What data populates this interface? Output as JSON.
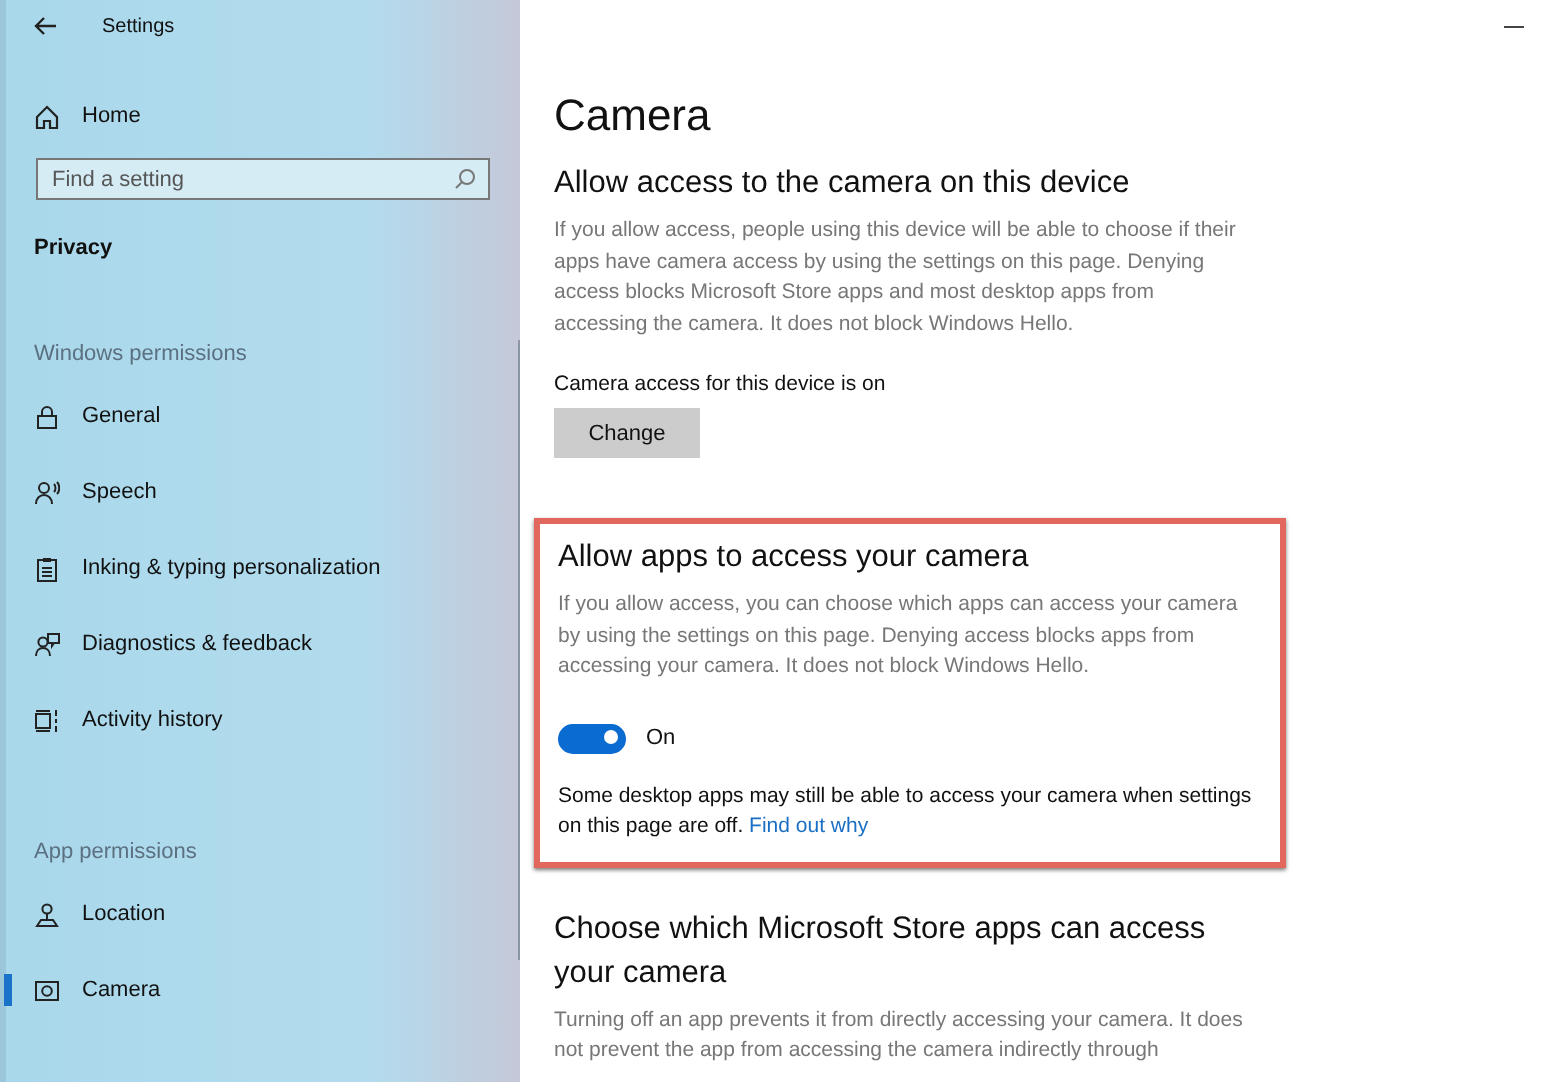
{
  "window": {
    "title": "Settings"
  },
  "sidebar": {
    "home": "Home",
    "search": {
      "placeholder": "Find a setting"
    },
    "heading": "Privacy",
    "groups": [
      {
        "title": "Windows permissions",
        "items": [
          {
            "label": "General",
            "selected": false
          },
          {
            "label": "Speech",
            "selected": false
          },
          {
            "label": "Inking & typing personalization",
            "selected": false
          },
          {
            "label": "Diagnostics & feedback",
            "selected": false
          },
          {
            "label": "Activity history",
            "selected": false
          }
        ]
      },
      {
        "title": "App permissions",
        "items": [
          {
            "label": "Location",
            "selected": false
          },
          {
            "label": "Camera",
            "selected": true
          }
        ]
      }
    ]
  },
  "page": {
    "title": "Camera",
    "device_section": {
      "heading": "Allow access to the camera on this device",
      "description": "If you allow access, people using this device will be able to choose if their apps have camera access by using the settings on this page. Denying access blocks Microsoft Store apps and most desktop apps from accessing the camera. It does not block Windows Hello.",
      "status": "Camera access for this device is on",
      "button": "Change"
    },
    "apps_section": {
      "highlighted": true,
      "heading": "Allow apps to access your camera",
      "description": "If you allow access, you can choose which apps can access your camera by using the settings on this page. Denying access blocks apps from accessing your camera. It does not block Windows Hello.",
      "toggle": {
        "on": true,
        "label": "On"
      },
      "note": "Some desktop apps may still be able to access your camera when settings on this page are off.",
      "link": "Find out why"
    },
    "store_section": {
      "heading": "Choose which Microsoft Store apps can access your camera",
      "description": "Turning off an app prevents it from directly accessing your camera. It does not prevent the app from accessing the camera indirectly through"
    }
  }
}
